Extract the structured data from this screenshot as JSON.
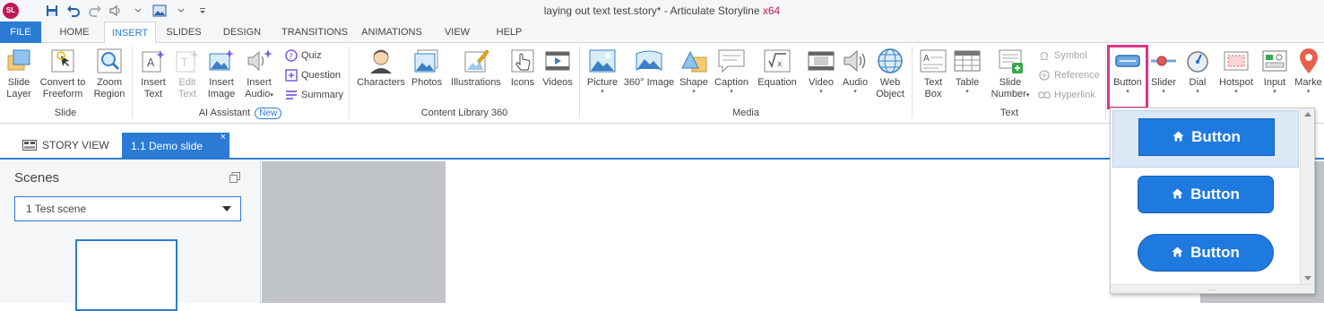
{
  "app": {
    "logo_text": "SL",
    "window_title": "laying out text test.story* -  Articulate Storyline",
    "arch": "x64"
  },
  "tabs": [
    {
      "label": "FILE"
    },
    {
      "label": "HOME"
    },
    {
      "label": "INSERT"
    },
    {
      "label": "SLIDES"
    },
    {
      "label": "DESIGN"
    },
    {
      "label": "TRANSITIONS"
    },
    {
      "label": "ANIMATIONS"
    },
    {
      "label": "VIEW"
    },
    {
      "label": "HELP"
    }
  ],
  "ribbon": {
    "slide_group": {
      "label": "Slide",
      "slide_layer": [
        "Slide",
        "Layer"
      ],
      "convert": [
        "Convert to",
        "Freeform"
      ],
      "zoom": [
        "Zoom",
        "Region"
      ]
    },
    "ai_group": {
      "label": "AI Assistant",
      "badge": "New",
      "insert_text": [
        "Insert",
        "Text"
      ],
      "edit_text": [
        "Edit",
        "Text"
      ],
      "insert_image": [
        "Insert",
        "Image"
      ],
      "insert_audio": [
        "Insert",
        "Audio"
      ],
      "quiz": "Quiz",
      "question": "Question",
      "summary": "Summary"
    },
    "content_group": {
      "label": "Content Library 360",
      "characters": "Characters",
      "photos": "Photos",
      "illustrations": "Illustrations",
      "icons": "Icons",
      "videos": "Videos"
    },
    "media_group": {
      "label": "Media",
      "picture": "Picture",
      "image360": "360° Image",
      "shape": "Shape",
      "caption": "Caption",
      "equation": "Equation",
      "video": "Video",
      "audio": "Audio",
      "web_object": [
        "Web",
        "Object"
      ]
    },
    "text_group": {
      "label": "Text",
      "text_box": [
        "Text",
        "Box"
      ],
      "table": "Table",
      "slide_number": [
        "Slide",
        "Number"
      ],
      "symbol": "Symbol",
      "reference": "Reference",
      "hyperlink": "Hyperlink"
    },
    "interactive": {
      "button": "Button",
      "slider": "Slider",
      "dial": "Dial",
      "hotspot": "Hotspot",
      "input": "Input",
      "marker": "Marke"
    }
  },
  "doc_tabs": {
    "story_view": "STORY VIEW",
    "demo_slide": "1.1 Demo slide",
    "close": "×"
  },
  "scenes_panel": {
    "title": "Scenes",
    "selected_scene": "1 Test scene"
  },
  "button_gallery": {
    "items": [
      {
        "label": "Button",
        "style": "square",
        "selected": true
      },
      {
        "label": "Button",
        "style": "rounded",
        "selected": false
      },
      {
        "label": "Button",
        "style": "pill",
        "selected": false
      }
    ],
    "grip": "....",
    "button_color": "#1f7ae0"
  },
  "colors": {
    "accent": "#2b7bd5",
    "highlight": "#e0338a",
    "brand": "#c2185b"
  }
}
